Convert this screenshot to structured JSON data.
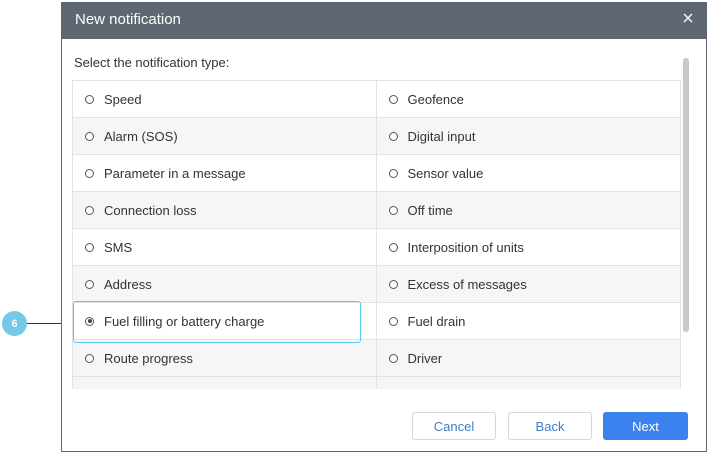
{
  "dialog": {
    "title": "New notification"
  },
  "prompt": "Select the notification type:",
  "types": [
    {
      "left": "Speed",
      "right": "Geofence"
    },
    {
      "left": "Alarm (SOS)",
      "right": "Digital input"
    },
    {
      "left": "Parameter in a message",
      "right": "Sensor value"
    },
    {
      "left": "Connection loss",
      "right": "Off time"
    },
    {
      "left": "SMS",
      "right": "Interposition of units"
    },
    {
      "left": "Address",
      "right": "Excess of messages"
    },
    {
      "left": "Fuel filling or battery charge",
      "right": "Fuel drain"
    },
    {
      "left": "Route progress",
      "right": "Driver"
    }
  ],
  "selected": "Fuel filling or battery charge",
  "buttons": {
    "cancel": "Cancel",
    "back": "Back",
    "next": "Next"
  },
  "callout": {
    "number": "6",
    "color": "#74c9e4"
  },
  "colors": {
    "titlebar": "#5f6773",
    "primary": "#3b82ef",
    "highlight": "#5bc8e8"
  },
  "icons": {
    "close": "close-icon"
  }
}
